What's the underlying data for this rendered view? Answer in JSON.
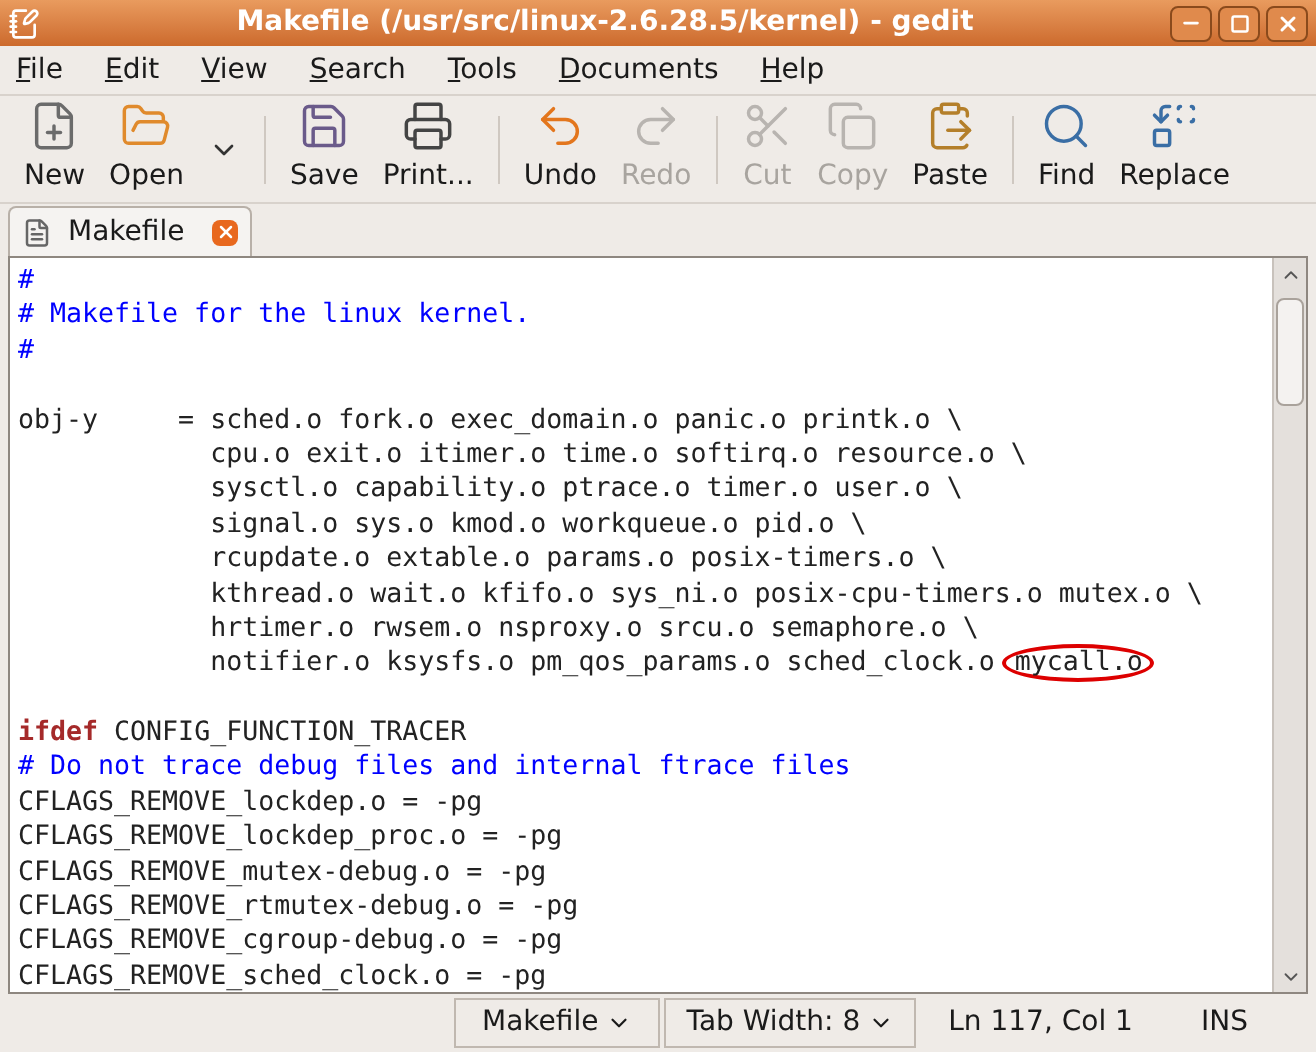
{
  "window": {
    "title": "Makefile (/usr/src/linux-2.6.28.5/kernel) - gedit"
  },
  "menu": [
    "File",
    "Edit",
    "View",
    "Search",
    "Tools",
    "Documents",
    "Help"
  ],
  "toolbar": [
    {
      "kind": "new",
      "label": "New",
      "disabled": false
    },
    {
      "kind": "open",
      "label": "Open",
      "disabled": false
    },
    {
      "kind": "save",
      "label": "Save",
      "disabled": false
    },
    {
      "kind": "print",
      "label": "Print...",
      "disabled": false
    },
    {
      "kind": "undo",
      "label": "Undo",
      "disabled": false
    },
    {
      "kind": "redo",
      "label": "Redo",
      "disabled": true
    },
    {
      "kind": "cut",
      "label": "Cut",
      "disabled": true
    },
    {
      "kind": "copy",
      "label": "Copy",
      "disabled": true
    },
    {
      "kind": "paste",
      "label": "Paste",
      "disabled": false
    },
    {
      "kind": "find",
      "label": "Find",
      "disabled": false
    },
    {
      "kind": "replace",
      "label": "Replace",
      "disabled": false
    }
  ],
  "tabs": [
    {
      "label": "Makefile",
      "selected": true
    }
  ],
  "editor": {
    "lines": [
      {
        "kind": "code",
        "segments": [
          {
            "kind": "comment",
            "text": "#"
          }
        ]
      },
      {
        "kind": "code",
        "segments": [
          {
            "kind": "comment",
            "text": "# Makefile for the linux kernel."
          }
        ]
      },
      {
        "kind": "code",
        "segments": [
          {
            "kind": "comment",
            "text": "#"
          }
        ]
      },
      {
        "kind": "blank"
      },
      {
        "kind": "code",
        "segments": [
          {
            "kind": "plain",
            "text": "obj-y     = sched.o fork.o exec_domain.o panic.o printk.o \\"
          }
        ]
      },
      {
        "kind": "code",
        "segments": [
          {
            "kind": "plain",
            "text": "            cpu.o exit.o itimer.o time.o softirq.o resource.o \\"
          }
        ]
      },
      {
        "kind": "code",
        "segments": [
          {
            "kind": "plain",
            "text": "            sysctl.o capability.o ptrace.o timer.o user.o \\"
          }
        ]
      },
      {
        "kind": "code",
        "segments": [
          {
            "kind": "plain",
            "text": "            signal.o sys.o kmod.o workqueue.o pid.o \\"
          }
        ]
      },
      {
        "kind": "code",
        "segments": [
          {
            "kind": "plain",
            "text": "            rcupdate.o extable.o params.o posix-timers.o \\"
          }
        ]
      },
      {
        "kind": "code",
        "segments": [
          {
            "kind": "plain",
            "text": "            kthread.o wait.o kfifo.o sys_ni.o posix-cpu-timers.o mutex.o \\"
          }
        ]
      },
      {
        "kind": "code",
        "segments": [
          {
            "kind": "plain",
            "text": "            hrtimer.o rwsem.o nsproxy.o srcu.o semaphore.o \\"
          }
        ]
      },
      {
        "kind": "code",
        "segments": [
          {
            "kind": "plain",
            "text": "            notifier.o ksysfs.o pm_qos_params.o sched_clock.o "
          },
          {
            "kind": "circled",
            "text": "mycall.o"
          }
        ]
      },
      {
        "kind": "blank"
      },
      {
        "kind": "code",
        "segments": [
          {
            "kind": "keyword",
            "text": "ifdef"
          },
          {
            "kind": "plain",
            "text": " CONFIG_FUNCTION_TRACER"
          }
        ]
      },
      {
        "kind": "code",
        "segments": [
          {
            "kind": "comment",
            "text": "# Do not trace debug files and internal ftrace files"
          }
        ]
      },
      {
        "kind": "code",
        "segments": [
          {
            "kind": "plain",
            "text": "CFLAGS_REMOVE_lockdep.o = -pg"
          }
        ]
      },
      {
        "kind": "code",
        "segments": [
          {
            "kind": "plain",
            "text": "CFLAGS_REMOVE_lockdep_proc.o = -pg"
          }
        ]
      },
      {
        "kind": "code",
        "segments": [
          {
            "kind": "plain",
            "text": "CFLAGS_REMOVE_mutex-debug.o = -pg"
          }
        ]
      },
      {
        "kind": "code",
        "segments": [
          {
            "kind": "plain",
            "text": "CFLAGS_REMOVE_rtmutex-debug.o = -pg"
          }
        ]
      },
      {
        "kind": "code",
        "segments": [
          {
            "kind": "plain",
            "text": "CFLAGS_REMOVE_cgroup-debug.o = -pg"
          }
        ]
      },
      {
        "kind": "code",
        "segments": [
          {
            "kind": "plain",
            "text": "CFLAGS_REMOVE_sched_clock.o = -pg"
          }
        ]
      }
    ]
  },
  "status_bar": {
    "language": "Makefile",
    "tab_width": "Tab Width: 8",
    "position": "Ln 117, Col 1",
    "mode": "INS"
  }
}
